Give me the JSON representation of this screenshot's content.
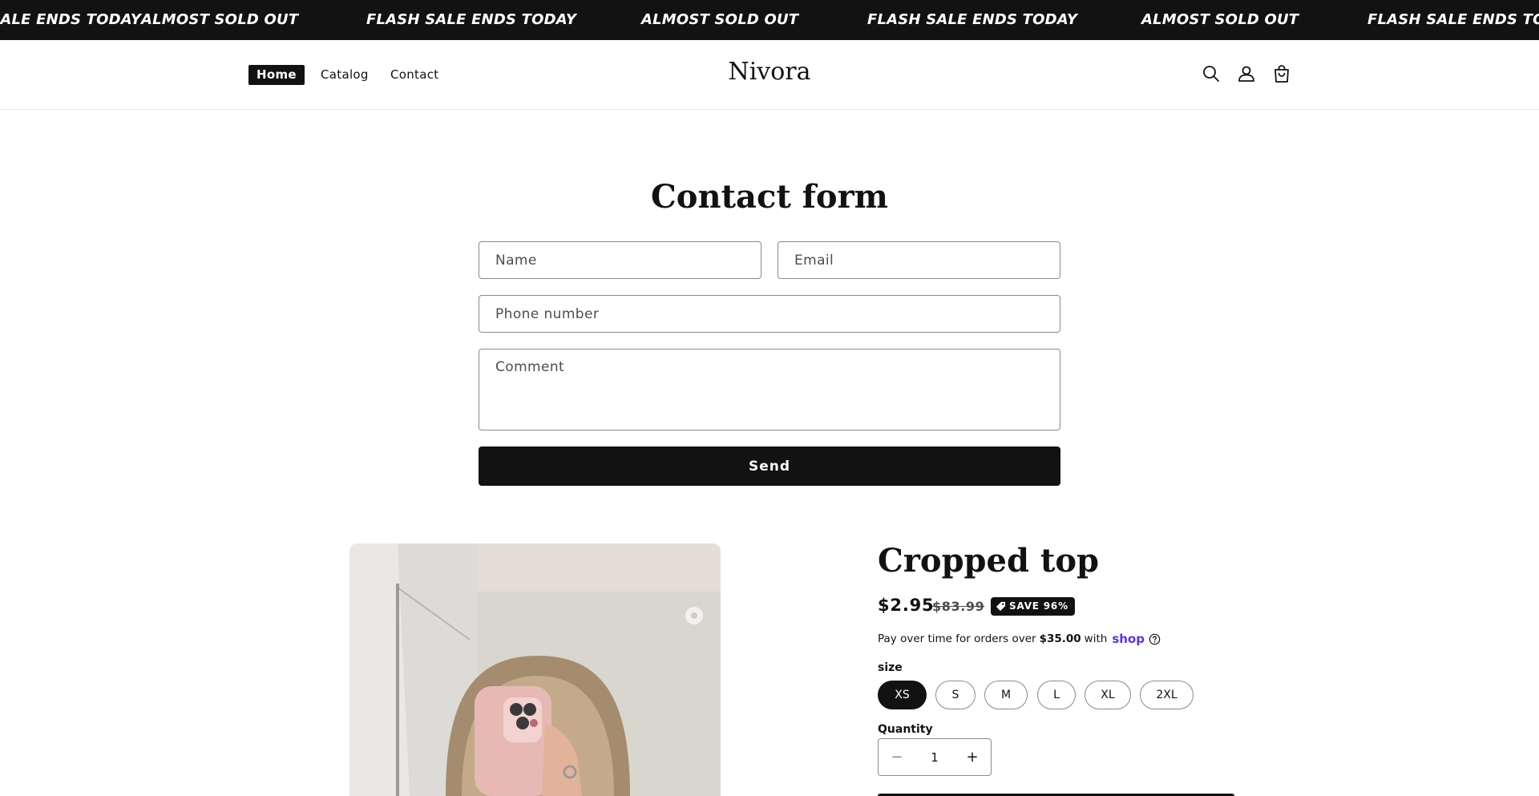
{
  "announcement": {
    "items": [
      "FLASH SALE ENDS TODAY",
      "ALMOST SOLD OUT",
      "FLASH SALE ENDS TODAY",
      "ALMOST SOLD OUT",
      "FLASH SALE ENDS TODAY",
      "ALMOST SOLD OUT",
      "FLASH SALE ENDS TODAY"
    ]
  },
  "header": {
    "nav": [
      {
        "label": "Home",
        "active": true
      },
      {
        "label": "Catalog",
        "active": false
      },
      {
        "label": "Contact",
        "active": false
      }
    ],
    "logo": "Nivora",
    "icons": [
      "search-icon",
      "account-icon",
      "cart-icon"
    ]
  },
  "contact_form": {
    "title": "Contact form",
    "name_placeholder": "Name",
    "email_placeholder": "Email",
    "phone_placeholder": "Phone number",
    "comment_placeholder": "Comment",
    "send_label": "Send"
  },
  "product": {
    "title": "Cropped top",
    "price": "$2.95",
    "compare_price": "$83.99",
    "badge": "SAVE 96%",
    "installments": {
      "prefix": "Pay over time for orders over",
      "amount": "$35.00",
      "suffix": "with",
      "brand": "shop"
    },
    "size_label": "size",
    "sizes": [
      "XS",
      "S",
      "M",
      "L",
      "XL",
      "2XL"
    ],
    "selected_size": "XS",
    "quantity_label": "Quantity",
    "quantity": "1",
    "minus_symbol": "−",
    "plus_symbol": "+"
  },
  "colors": {
    "primary": "#121212",
    "shop_brand": "#5a31f4",
    "background": "#ffffff"
  }
}
